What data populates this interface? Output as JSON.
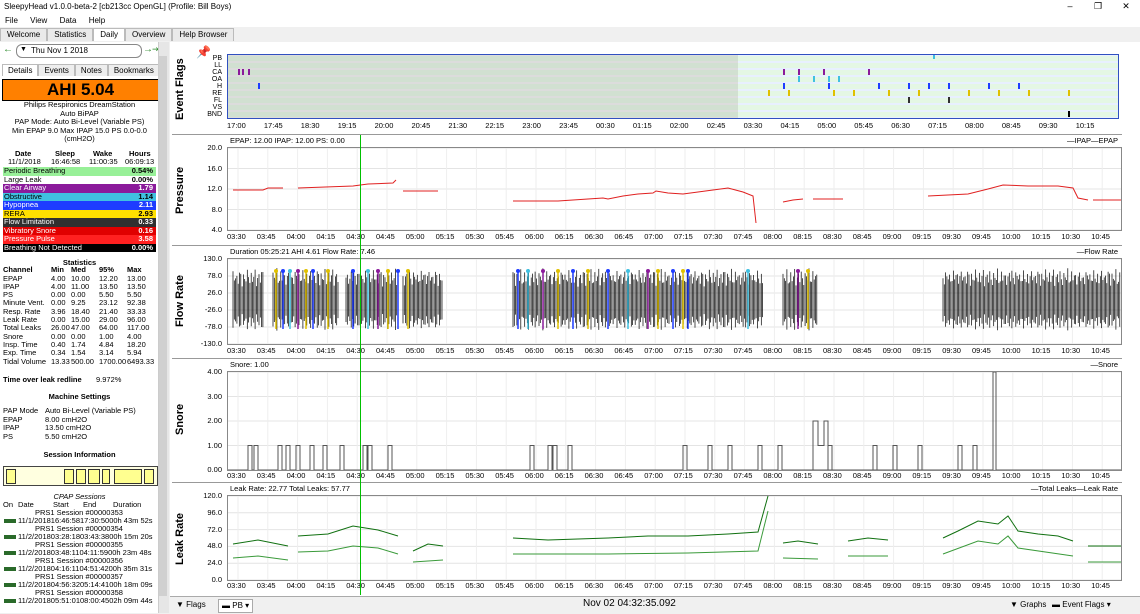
{
  "window": {
    "title": "SleepyHead v1.0.0-beta-2 [cb213cc OpenGL] (Profile: Bill Boys)",
    "minimize": "–",
    "maximize": "❐",
    "close": "✕"
  },
  "menu": [
    "File",
    "View",
    "Data",
    "Help"
  ],
  "tabs": [
    "Welcome",
    "Statistics",
    "Daily",
    "Overview",
    "Help Browser"
  ],
  "date": "Thu Nov 1 2018",
  "subtabs": [
    "Details",
    "Events",
    "Notes",
    "Bookmarks"
  ],
  "ahi": "AHI 5.04",
  "machine": [
    "Philips Respironics DreamStation",
    "Auto BiPAP",
    "PAP Mode: Auto Bi-Level (Variable PS)",
    "Min EPAP 9.0 Max IPAP 15.0 PS 0.0-0.0",
    "(cmH2O)"
  ],
  "session_header": {
    "cols": [
      "Date",
      "Sleep",
      "Wake",
      "Hours"
    ],
    "vals": [
      "11/1/2018",
      "16:46:58",
      "11:00:35",
      "06:09:13"
    ]
  },
  "events": [
    {
      "name": "Periodic Breathing",
      "value": "0.54%",
      "color": "#98f098"
    },
    {
      "name": "Large Leak",
      "value": "0.00%",
      "color": "#ffffff"
    },
    {
      "name": "Clear Airway",
      "value": "1.79",
      "color": "#8b1a9b"
    },
    {
      "name": "Obstructive",
      "value": "1.14",
      "color": "#40c0e0"
    },
    {
      "name": "Hypopnea",
      "value": "2.11",
      "color": "#1e3cff"
    },
    {
      "name": "RERA",
      "value": "2.93",
      "color": "#ffe000"
    },
    {
      "name": "Flow Limitation",
      "value": "0.33",
      "color": "#303030"
    },
    {
      "name": "Vibratory Snore",
      "value": "0.16",
      "color": "#e00000"
    },
    {
      "name": "Pressure Pulse",
      "value": "3.58",
      "color": "#ff2020"
    },
    {
      "name": "Breathing Not Detected",
      "value": "0.00%",
      "color": "#000000"
    }
  ],
  "statistics": {
    "title": "Statistics",
    "cols": [
      "Channel",
      "Min",
      "Med",
      "95%",
      "Max"
    ],
    "rows": [
      [
        "EPAP",
        "4.00",
        "10.00",
        "12.20",
        "13.00"
      ],
      [
        "IPAP",
        "4.00",
        "11.00",
        "13.50",
        "13.50"
      ],
      [
        "PS",
        "0.00",
        "0.00",
        "5.50",
        "5.50"
      ],
      [
        "Minute Vent.",
        "0.00",
        "9.25",
        "23.12",
        "92.38"
      ],
      [
        "Resp. Rate",
        "3.96",
        "18.40",
        "21.40",
        "33.33"
      ],
      [
        "Leak Rate",
        "0.00",
        "15.00",
        "29.00",
        "96.00"
      ],
      [
        "Total Leaks",
        "26.00",
        "47.00",
        "64.00",
        "117.00"
      ],
      [
        "Snore",
        "0.00",
        "0.00",
        "1.00",
        "4.00"
      ],
      [
        "Insp. Time",
        "0.40",
        "1.74",
        "4.84",
        "18.20"
      ],
      [
        "Exp. Time",
        "0.34",
        "1.54",
        "3.14",
        "5.94"
      ],
      [
        "Tidal Volume",
        "13.33",
        "500.00",
        "1700.00",
        "6493.33"
      ]
    ]
  },
  "leak_redline": {
    "label": "Time over leak redline",
    "value": "9.972%"
  },
  "machine_settings": {
    "title": "Machine Settings",
    "rows": [
      [
        "PAP Mode",
        "Auto Bi-Level (Variable PS)"
      ],
      [
        "EPAP",
        "8.00 cmH2O"
      ],
      [
        "IPAP",
        "13.50 cmH2O"
      ],
      [
        "PS",
        "5.50 cmH2O"
      ]
    ]
  },
  "session_info": {
    "title": "Session Information",
    "sub": "CPAP Sessions",
    "cols": [
      "On",
      "Date",
      "Start",
      "End",
      "Duration"
    ]
  },
  "sessions": [
    {
      "name": "PRS1 Session #00000353",
      "row": "11/1/201816:46:5817:30:5000h 43m 52s"
    },
    {
      "name": "PRS1 Session #00000354",
      "row": "11/2/201803:28:1803:43:3800h 15m 20s"
    },
    {
      "name": "PRS1 Session #00000355",
      "row": "11/2/201803:48:1104:11:5900h 23m 48s"
    },
    {
      "name": "PRS1 Session #00000356",
      "row": "11/2/201804:16:1104:51:4200h 35m 31s"
    },
    {
      "name": "PRS1 Session #00000357",
      "row": "11/2/201804:56:3205:14:4100h 18m 09s"
    },
    {
      "name": "PRS1 Session #00000358",
      "row": "11/2/201805:51:0108:00:4502h 09m 44s"
    }
  ],
  "event_flags": {
    "title": "Event Flags",
    "labels": [
      "PB",
      "LL",
      "CA",
      "OA",
      "H",
      "RE",
      "FL",
      "VS",
      "BND"
    ],
    "ticks": [
      "17:00",
      "17:45",
      "18:30",
      "19:15",
      "20:00",
      "20:45",
      "21:30",
      "22:15",
      "23:00",
      "23:45",
      "00:30",
      "01:15",
      "02:00",
      "02:45",
      "03:30",
      "04:15",
      "05:00",
      "05:45",
      "06:30",
      "07:15",
      "08:00",
      "08:45",
      "09:30",
      "10:15"
    ]
  },
  "time_ticks": [
    "03:30",
    "03:45",
    "04:00",
    "04:15",
    "04:30",
    "04:45",
    "05:00",
    "05:15",
    "05:30",
    "05:45",
    "06:00",
    "06:15",
    "06:30",
    "06:45",
    "07:00",
    "07:15",
    "07:30",
    "07:45",
    "08:00",
    "08:15",
    "08:30",
    "08:45",
    "09:00",
    "09:15",
    "09:30",
    "09:45",
    "10:00",
    "10:15",
    "10:30",
    "10:45"
  ],
  "pressure": {
    "title": "Pressure",
    "header": "EPAP: 12.00 IPAP: 12.00 PS: 0.00",
    "legend": "—IPAP—EPAP",
    "yticks": [
      "20.0",
      "16.0",
      "12.0",
      "8.0",
      "4.0"
    ]
  },
  "flow": {
    "title": "Flow Rate",
    "header": "Duration 05:25:21 AHI 4.61 Flow Rate: 7.46",
    "legend": "—Flow Rate",
    "yticks": [
      "130.0",
      "78.0",
      "26.0",
      "-26.0",
      "-78.0",
      "-130.0"
    ]
  },
  "snore": {
    "title": "Snore",
    "header": "Snore: 1.00",
    "legend": "—Snore",
    "yticks": [
      "4.00",
      "3.00",
      "2.00",
      "1.00",
      "0.00"
    ]
  },
  "leak": {
    "title": "Leak Rate",
    "header": "Leak Rate: 22.77 Total Leaks: 57.77",
    "legend": "—Total Leaks—Leak Rate",
    "yticks": [
      "120.0",
      "96.0",
      "72.0",
      "48.0",
      "24.0",
      "0.0"
    ]
  },
  "status": {
    "flags": "Flags",
    "pb": "PB",
    "datetime": "Nov 02 04:32:35.092",
    "graphs": "Graphs",
    "eventflags": "Event Flags"
  },
  "colors": {
    "ahi_bg": "#ff8000",
    "pressure_line": "#e02020",
    "leak_line": "#107010",
    "cursor": "#00c000"
  }
}
